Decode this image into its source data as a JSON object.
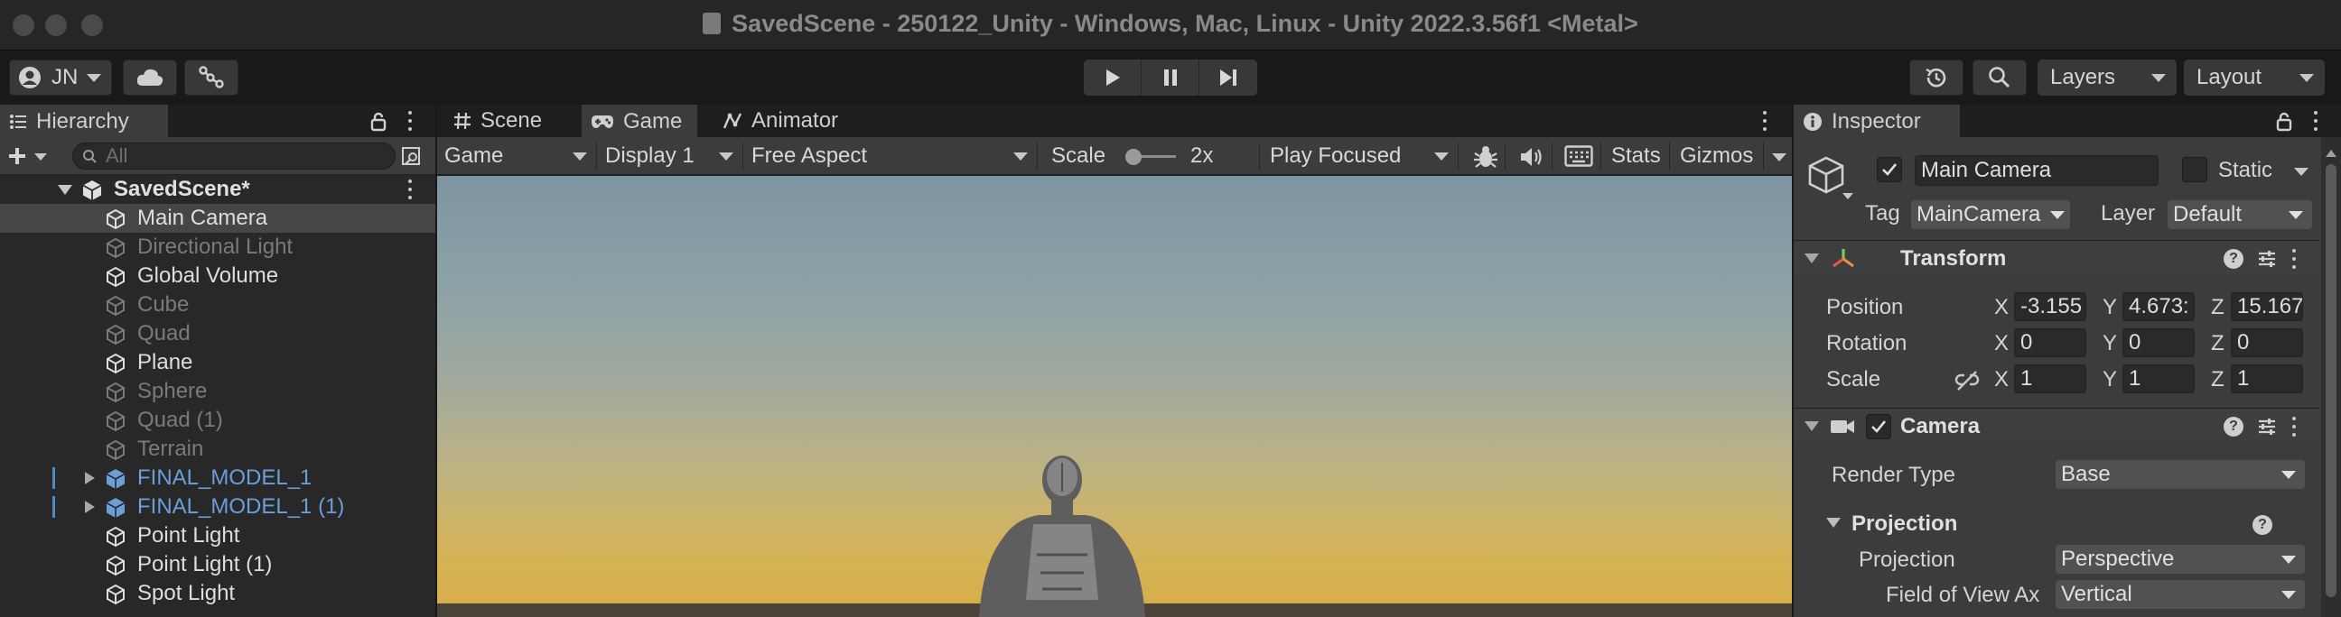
{
  "window": {
    "title": "SavedScene - 250122_Unity - Windows, Mac, Linux - Unity 2022.3.56f1 <Metal>"
  },
  "toolbar": {
    "account": "JN",
    "layers": "Layers",
    "layout": "Layout"
  },
  "hierarchy": {
    "tab": "Hierarchy",
    "search_placeholder": "All",
    "scene": "SavedScene*",
    "items": [
      {
        "label": "Main Camera",
        "state": "selected"
      },
      {
        "label": "Directional Light",
        "state": "inactive"
      },
      {
        "label": "Global Volume",
        "state": "active"
      },
      {
        "label": "Cube",
        "state": "inactive"
      },
      {
        "label": "Quad",
        "state": "inactive"
      },
      {
        "label": "Plane",
        "state": "active"
      },
      {
        "label": "Sphere",
        "state": "inactive"
      },
      {
        "label": "Quad (1)",
        "state": "inactive"
      },
      {
        "label": "Terrain",
        "state": "inactive"
      },
      {
        "label": "FINAL_MODEL_1",
        "state": "prefab"
      },
      {
        "label": "FINAL_MODEL_1 (1)",
        "state": "prefab"
      },
      {
        "label": "Point Light",
        "state": "active"
      },
      {
        "label": "Point Light (1)",
        "state": "active"
      },
      {
        "label": "Spot Light",
        "state": "active"
      }
    ]
  },
  "center_tabs": [
    "Scene",
    "Game",
    "Animator"
  ],
  "game_toolbar": {
    "view": "Game",
    "display": "Display 1",
    "aspect": "Free Aspect",
    "scale_label": "Scale",
    "scale_value": "2x",
    "play_mode": "Play Focused",
    "stats": "Stats",
    "gizmos": "Gizmos"
  },
  "inspector": {
    "tab": "Inspector",
    "object_name": "Main Camera",
    "static_label": "Static",
    "tag_label": "Tag",
    "tag_value": "MainCamera",
    "layer_label": "Layer",
    "layer_value": "Default",
    "transform": {
      "title": "Transform",
      "position_label": "Position",
      "rotation_label": "Rotation",
      "scale_label": "Scale",
      "axis_x": "X",
      "axis_y": "Y",
      "axis_z": "Z",
      "position": [
        "-3.155",
        "4.673:",
        "15.167"
      ],
      "rotation": [
        "0",
        "0",
        "0"
      ],
      "scale": [
        "1",
        "1",
        "1"
      ]
    },
    "camera": {
      "title": "Camera",
      "render_type_label": "Render Type",
      "render_type": "Base",
      "projection_section": "Projection",
      "projection_label": "Projection",
      "projection": "Perspective",
      "fov_axis_label": "Field of View Ax",
      "fov_axis": "Vertical"
    }
  }
}
